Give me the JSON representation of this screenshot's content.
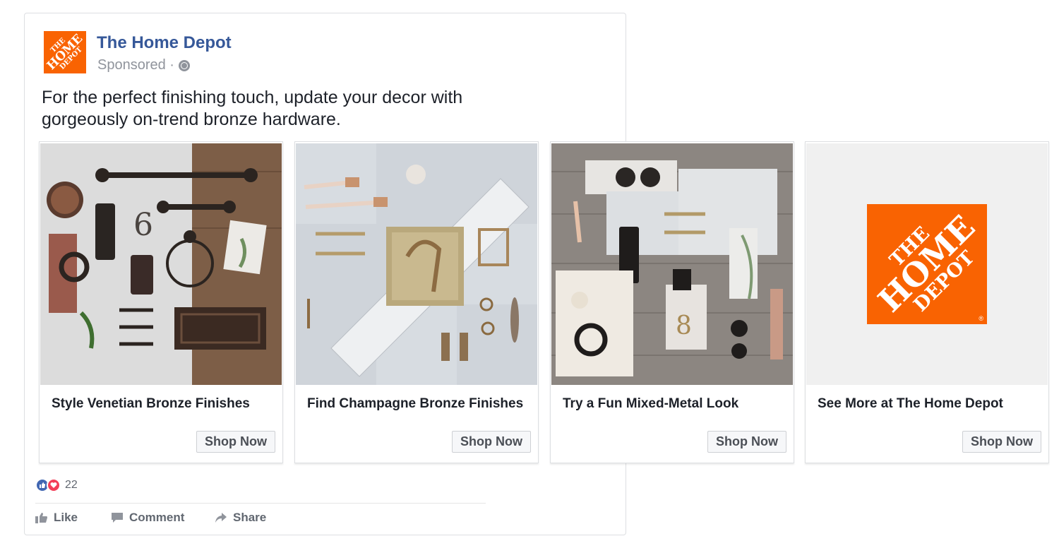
{
  "page": {
    "name": "The Home Depot",
    "sponsored": "Sponsored ·",
    "logo_lines": [
      "THE",
      "HOME",
      "DEPOT"
    ]
  },
  "post": {
    "text_line1": "For the perfect finishing touch, update your decor with",
    "text_line2": "gorgeously on-trend bronze hardware."
  },
  "cards": [
    {
      "title": "Style Venetian Bronze Finishes",
      "button": "Shop Now"
    },
    {
      "title": "Find Champagne Bronze Finishes",
      "button": "Shop Now"
    },
    {
      "title": "Try a Fun Mixed-Metal Look",
      "button": "Shop Now"
    },
    {
      "title": "See More at The Home Depot",
      "button": "Shop Now"
    }
  ],
  "reactions": {
    "count": "22"
  },
  "actions": {
    "like": "Like",
    "comment": "Comment",
    "share": "Share"
  },
  "colors": {
    "brand_orange": "#f96302",
    "link_blue": "#365899"
  },
  "logo_registered": "®"
}
